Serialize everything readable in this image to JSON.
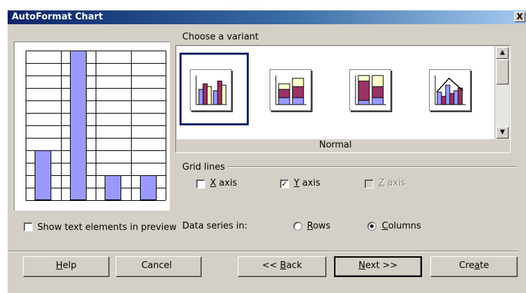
{
  "dialog": {
    "title": "AutoFormat Chart",
    "close_glyph": "X"
  },
  "preview": {
    "chart_data": {
      "type": "bar",
      "categories": [
        "1",
        "2",
        "3",
        "4"
      ],
      "values": [
        4,
        12,
        2,
        2
      ],
      "ylim": [
        0,
        12
      ],
      "grid": "y"
    }
  },
  "show_text": {
    "label": "Show text elements in preview",
    "checked": false
  },
  "variants": {
    "heading": "Choose a variant",
    "selected_name": "Normal",
    "items": [
      "Normal",
      "Stacked",
      "Percent stacked",
      "Chart with lines"
    ]
  },
  "grid_lines": {
    "heading": "Grid lines",
    "x_axis": {
      "label": "X axis",
      "checked": false,
      "enabled": true
    },
    "y_axis": {
      "label": "Y axis",
      "checked": true,
      "enabled": true
    },
    "z_axis": {
      "label": "Z axis",
      "checked": false,
      "enabled": false
    }
  },
  "data_series": {
    "label": "Data series in:",
    "rows_label": "Rows",
    "columns_label": "Columns",
    "selected": "Columns"
  },
  "buttons": {
    "help": "Help",
    "cancel": "Cancel",
    "back": "<< Back",
    "next": "Next >>",
    "create": "Create"
  },
  "colors": {
    "title_bar": "#0a246a",
    "bar_fill": "#9999ff",
    "bar_dark": "#993366",
    "bar_light": "#ffffcc"
  }
}
